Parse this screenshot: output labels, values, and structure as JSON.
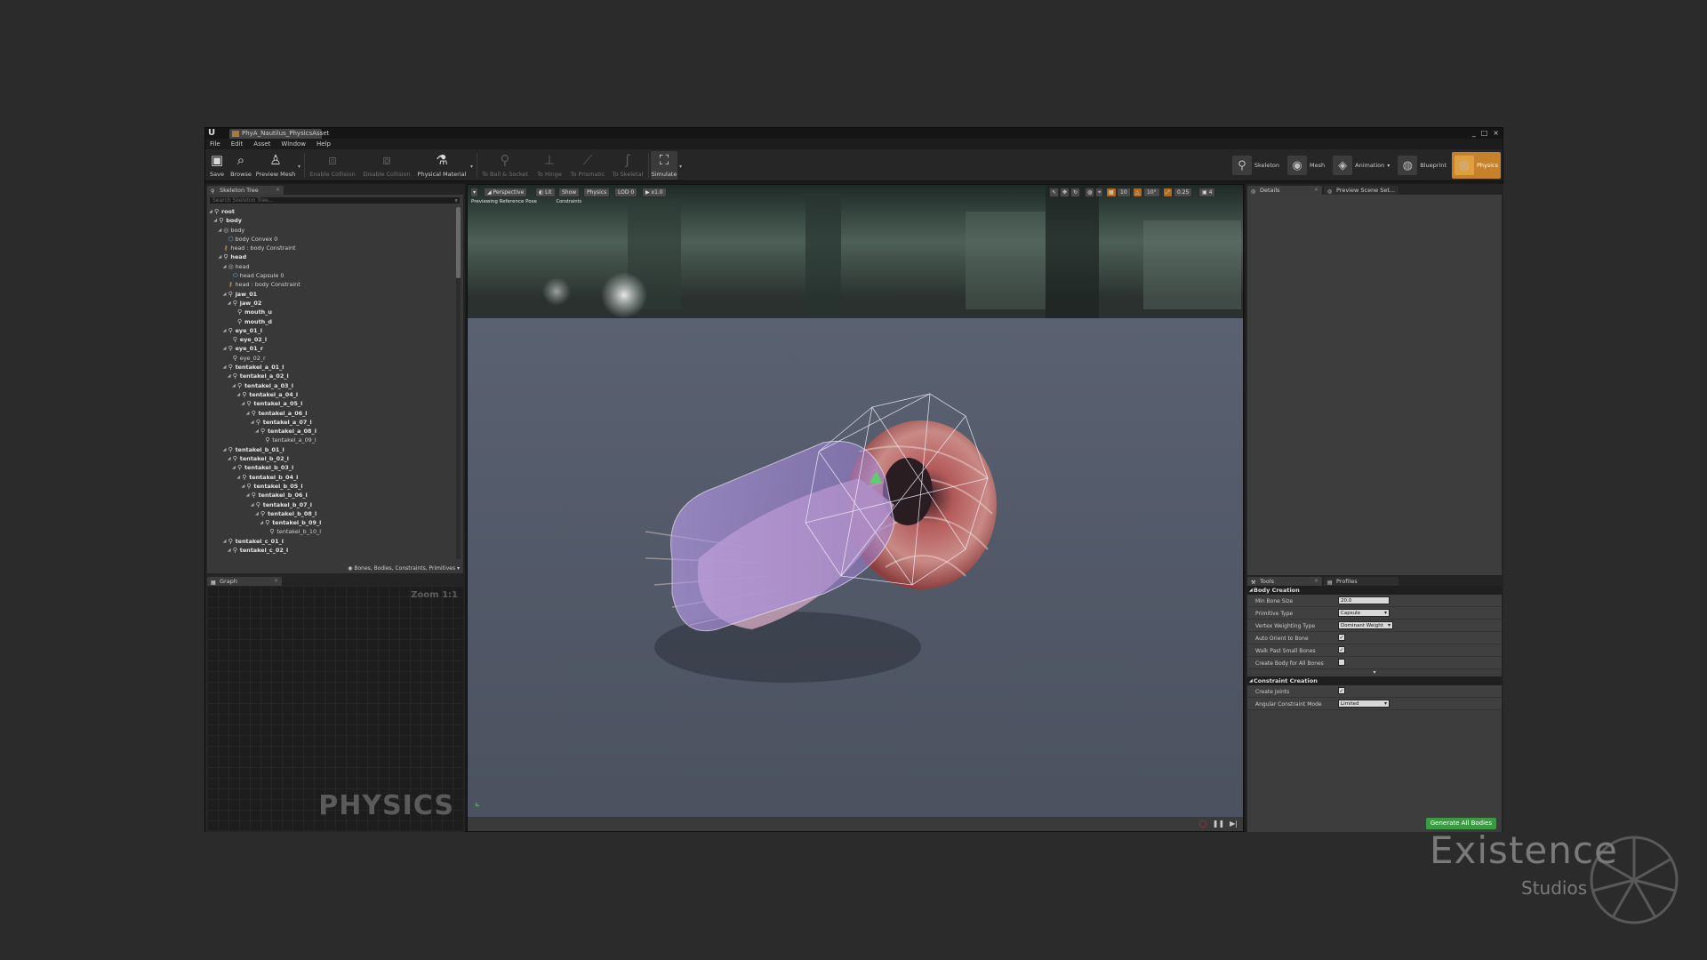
{
  "window": {
    "doc_tab": "PhyA_Nautilus_PhysicsAsset",
    "controls": [
      "_",
      "□",
      "×"
    ]
  },
  "menu": [
    "File",
    "Edit",
    "Asset",
    "Window",
    "Help"
  ],
  "toolbar": {
    "save": "Save",
    "browse": "Browse",
    "preview_mesh": "Preview Mesh",
    "enable_collision": "Enable Collision",
    "disable_collision": "Disable Collision",
    "physical_material": "Physical Material",
    "to_ball_socket": "To Ball & Socket",
    "to_hinge": "To Hinge",
    "to_prismatic": "To Prismatic",
    "to_skeletal": "To Skeletal",
    "simulate": "Simulate"
  },
  "modes": [
    {
      "label": "Skeleton",
      "icon": "skeleton-mode-icon"
    },
    {
      "label": "Mesh",
      "icon": "mesh-mode-icon"
    },
    {
      "label": "Animation",
      "icon": "animation-mode-icon"
    },
    {
      "label": "Blueprint",
      "icon": "blueprint-mode-icon"
    },
    {
      "label": "Physics",
      "icon": "physics-mode-icon"
    }
  ],
  "skeleton_tree": {
    "tab": "Skeleton Tree",
    "search_placeholder": "Search Skeleton Tree...",
    "footer": "Bones, Bodies, Constraints, Primitives",
    "rows": [
      {
        "label": "root",
        "indent": 0,
        "icon": "bone",
        "exp": true,
        "bold": true
      },
      {
        "label": "body",
        "indent": 1,
        "icon": "bone",
        "exp": true,
        "bold": true
      },
      {
        "label": "body",
        "indent": 2,
        "icon": "body",
        "exp": true,
        "bold": false
      },
      {
        "label": "body Convex 0",
        "indent": 3,
        "icon": "convex",
        "exp": false,
        "bold": false
      },
      {
        "label": "head : body Constraint",
        "indent": 2,
        "icon": "constraint",
        "exp": false,
        "bold": false
      },
      {
        "label": "head",
        "indent": 2,
        "icon": "bone",
        "exp": true,
        "bold": true
      },
      {
        "label": "head",
        "indent": 3,
        "icon": "body",
        "exp": true,
        "bold": false
      },
      {
        "label": "head Capsule 0",
        "indent": 4,
        "icon": "capsule",
        "exp": false,
        "bold": false
      },
      {
        "label": "head : body Constraint",
        "indent": 3,
        "icon": "constraint",
        "exp": false,
        "bold": false
      },
      {
        "label": "jaw_01",
        "indent": 3,
        "icon": "bone",
        "exp": true,
        "bold": true
      },
      {
        "label": "jaw_02",
        "indent": 4,
        "icon": "bone",
        "exp": true,
        "bold": true
      },
      {
        "label": "mouth_u",
        "indent": 5,
        "icon": "bone",
        "exp": false,
        "bold": true
      },
      {
        "label": "mouth_d",
        "indent": 5,
        "icon": "bone",
        "exp": false,
        "bold": true
      },
      {
        "label": "eye_01_l",
        "indent": 3,
        "icon": "bone",
        "exp": true,
        "bold": true
      },
      {
        "label": "eye_02_l",
        "indent": 4,
        "icon": "bone",
        "exp": false,
        "bold": true
      },
      {
        "label": "eye_01_r",
        "indent": 3,
        "icon": "bone",
        "exp": true,
        "bold": true
      },
      {
        "label": "eye_02_r",
        "indent": 4,
        "icon": "bone",
        "exp": false,
        "bold": false
      },
      {
        "label": "tentakel_a_01_l",
        "indent": 3,
        "icon": "bone",
        "exp": true,
        "bold": true
      },
      {
        "label": "tentakel_a_02_l",
        "indent": 4,
        "icon": "bone",
        "exp": true,
        "bold": true
      },
      {
        "label": "tentakel_a_03_l",
        "indent": 5,
        "icon": "bone",
        "exp": true,
        "bold": true
      },
      {
        "label": "tentakel_a_04_l",
        "indent": 6,
        "icon": "bone",
        "exp": true,
        "bold": true
      },
      {
        "label": "tentakel_a_05_l",
        "indent": 7,
        "icon": "bone",
        "exp": true,
        "bold": true
      },
      {
        "label": "tentakel_a_06_l",
        "indent": 8,
        "icon": "bone",
        "exp": true,
        "bold": true
      },
      {
        "label": "tentakel_a_07_l",
        "indent": 9,
        "icon": "bone",
        "exp": true,
        "bold": true
      },
      {
        "label": "tentakel_a_08_l",
        "indent": 10,
        "icon": "bone",
        "exp": true,
        "bold": true
      },
      {
        "label": "tentakel_a_09_l",
        "indent": 11,
        "icon": "bone",
        "exp": false,
        "bold": false
      },
      {
        "label": "tentakel_b_01_l",
        "indent": 3,
        "icon": "bone",
        "exp": true,
        "bold": true
      },
      {
        "label": "tentakel_b_02_l",
        "indent": 4,
        "icon": "bone",
        "exp": true,
        "bold": true
      },
      {
        "label": "tentakel_b_03_l",
        "indent": 5,
        "icon": "bone",
        "exp": true,
        "bold": true
      },
      {
        "label": "tentakel_b_04_l",
        "indent": 6,
        "icon": "bone",
        "exp": true,
        "bold": true
      },
      {
        "label": "tentakel_b_05_l",
        "indent": 7,
        "icon": "bone",
        "exp": true,
        "bold": true
      },
      {
        "label": "tentakel_b_06_l",
        "indent": 8,
        "icon": "bone",
        "exp": true,
        "bold": true
      },
      {
        "label": "tentakel_b_07_l",
        "indent": 9,
        "icon": "bone",
        "exp": true,
        "bold": true
      },
      {
        "label": "tentakel_b_08_l",
        "indent": 10,
        "icon": "bone",
        "exp": true,
        "bold": true
      },
      {
        "label": "tentakel_b_09_l",
        "indent": 11,
        "icon": "bone",
        "exp": true,
        "bold": true
      },
      {
        "label": "tentakel_b_10_l",
        "indent": 12,
        "icon": "bone",
        "exp": false,
        "bold": false
      },
      {
        "label": "tentakel_c_01_l",
        "indent": 3,
        "icon": "bone",
        "exp": true,
        "bold": true
      },
      {
        "label": "tentakel_c_02_l",
        "indent": 4,
        "icon": "bone",
        "exp": true,
        "bold": true
      }
    ]
  },
  "graph": {
    "tab": "Graph",
    "zoom": "Zoom 1:1",
    "watermark": "PHYSICS"
  },
  "viewport": {
    "perspective": "Perspective",
    "lit": "Lit",
    "show": "Show",
    "physics": "Physics",
    "lod": "LOD 0",
    "speed": "x1.0",
    "info_line1": "Previewing Reference Pose",
    "info_line2": "Constraints",
    "right_values": [
      "10",
      "10°",
      "0.25",
      "4"
    ]
  },
  "details": {
    "tab": "Details",
    "tab2": "Preview Scene Set..."
  },
  "tools": {
    "tab": "Tools",
    "tab2": "Profiles",
    "body_creation": {
      "title": "Body Creation",
      "min_bone_size_label": "Min Bone Size",
      "min_bone_size": "20.0",
      "primitive_type_label": "Primitive Type",
      "primitive_type": "Capsule",
      "vertex_weighting_label": "Vertex Weighting Type",
      "vertex_weighting": "Dominant Weight",
      "auto_orient_label": "Auto Orient to Bone",
      "walk_past_label": "Walk Past Small Bones",
      "create_body_all_label": "Create Body for All Bones"
    },
    "constraint_creation": {
      "title": "Constraint Creation",
      "create_joints_label": "Create Joints",
      "angular_mode_label": "Angular Constraint Mode",
      "angular_mode": "Limited"
    },
    "generate_button": "Generate All Bodies"
  },
  "brand": {
    "name": "Existence",
    "sub": "Studios"
  },
  "colors": {
    "accent_orange": "#c6822a",
    "generate_green": "#3c9a42",
    "physics_body_purple": "#a98ad8"
  }
}
